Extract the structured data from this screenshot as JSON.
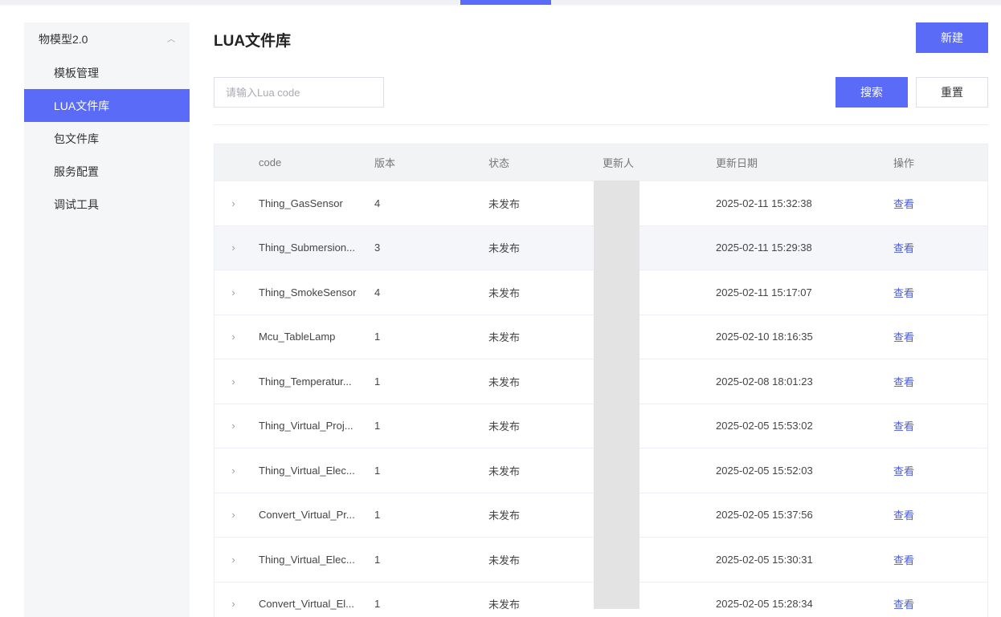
{
  "sidebar": {
    "group_title": "物模型2.0",
    "items": [
      {
        "label": "模板管理",
        "active": false
      },
      {
        "label": "LUA文件库",
        "active": true
      },
      {
        "label": "包文件库",
        "active": false
      },
      {
        "label": "服务配置",
        "active": false
      },
      {
        "label": "调试工具",
        "active": false
      }
    ]
  },
  "page": {
    "title": "LUA文件库",
    "new_button": "新建",
    "search_placeholder": "请输入Lua code",
    "search_button": "搜索",
    "reset_button": "重置"
  },
  "table": {
    "columns": [
      "code",
      "版本",
      "状态",
      "更新人",
      "更新日期",
      "操作"
    ],
    "rows": [
      {
        "code": "Thing_GasSensor",
        "version": "4",
        "status": "未发布",
        "date": "2025-02-11 15:32:38",
        "action": "查看"
      },
      {
        "code": "Thing_Submersion...",
        "version": "3",
        "status": "未发布",
        "date": "2025-02-11 15:29:38",
        "action": "查看"
      },
      {
        "code": "Thing_SmokeSensor",
        "version": "4",
        "status": "未发布",
        "date": "2025-02-11 15:17:07",
        "action": "查看"
      },
      {
        "code": "Mcu_TableLamp",
        "version": "1",
        "status": "未发布",
        "date": "2025-02-10 18:16:35",
        "action": "查看"
      },
      {
        "code": "Thing_Temperatur...",
        "version": "1",
        "status": "未发布",
        "date": "2025-02-08 18:01:23",
        "action": "查看"
      },
      {
        "code": "Thing_Virtual_Proj...",
        "version": "1",
        "status": "未发布",
        "date": "2025-02-05 15:53:02",
        "action": "查看"
      },
      {
        "code": "Thing_Virtual_Elec...",
        "version": "1",
        "status": "未发布",
        "date": "2025-02-05 15:52:03",
        "action": "查看"
      },
      {
        "code": "Convert_Virtual_Pr...",
        "version": "1",
        "status": "未发布",
        "date": "2025-02-05 15:37:56",
        "action": "查看"
      },
      {
        "code": "Thing_Virtual_Elec...",
        "version": "1",
        "status": "未发布",
        "date": "2025-02-05 15:30:31",
        "action": "查看"
      },
      {
        "code": "Convert_Virtual_El...",
        "version": "1",
        "status": "未发布",
        "date": "2025-02-05 15:28:34",
        "action": "查看"
      }
    ]
  },
  "colors": {
    "primary": "#5a6cf7",
    "link": "#4a5bd9",
    "sidebar_bg": "#f5f6f8"
  },
  "icons": {
    "collapse": "chevron-up-icon",
    "expand_row": "chevron-right-icon"
  }
}
